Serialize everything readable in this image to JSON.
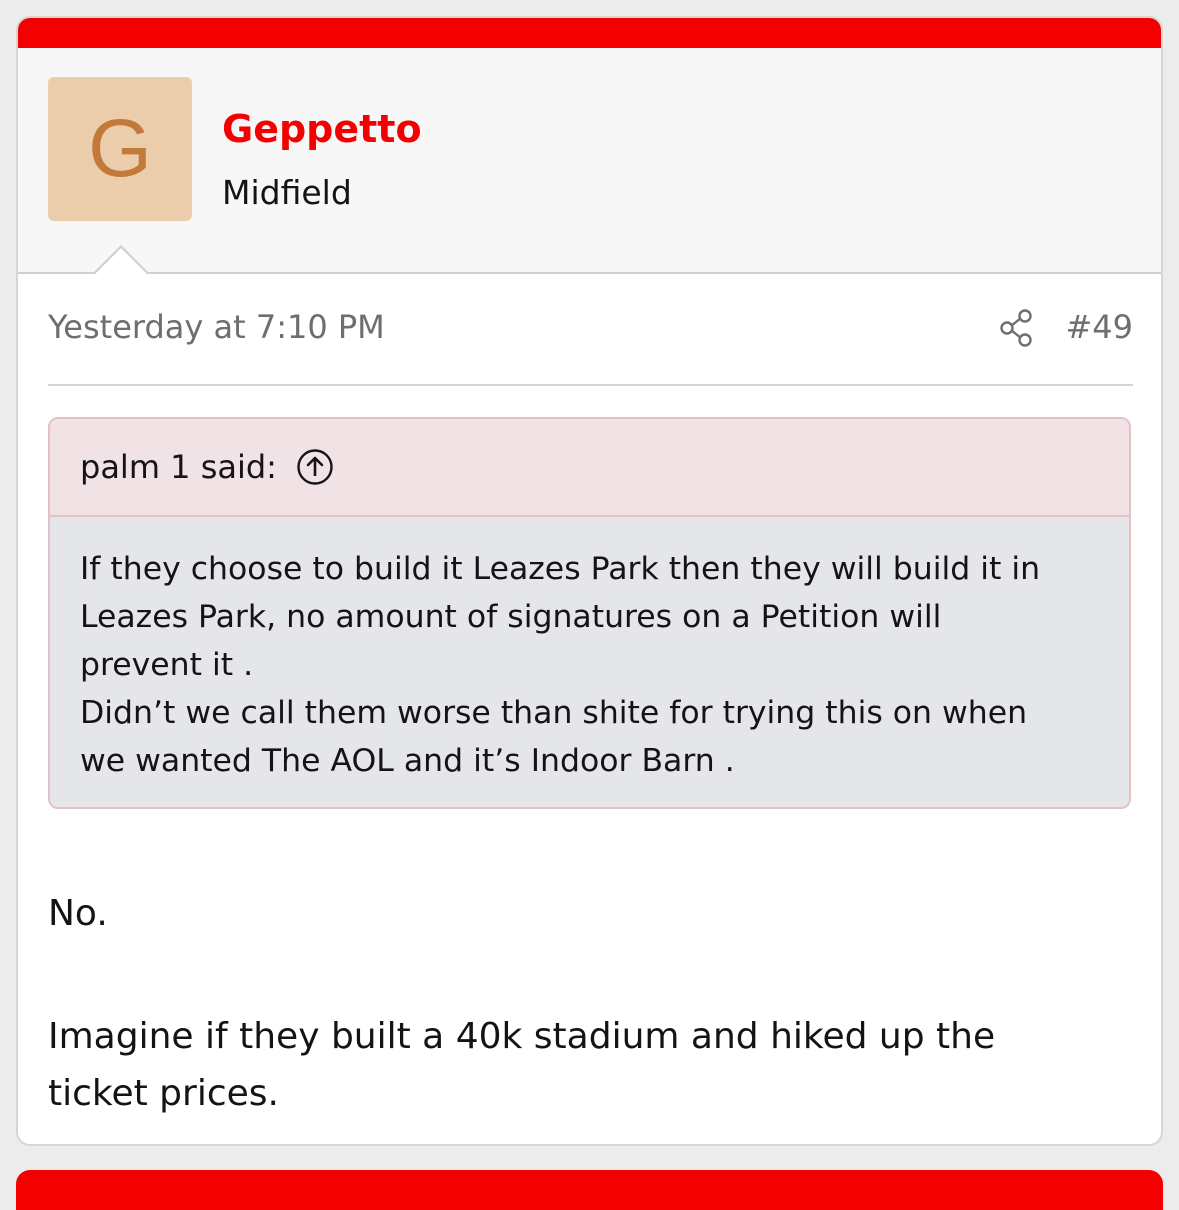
{
  "post": {
    "author": {
      "avatar_letter": "G",
      "username": "Geppetto",
      "user_title": "Midfield"
    },
    "meta": {
      "date": "Yesterday at 7:10 PM",
      "post_number": "#49",
      "share_icon": "share-icon"
    },
    "quote": {
      "author_label": "palm 1 said:",
      "jump_icon": "arrow-up-circle-icon",
      "lines": [
        "If they choose to build it Leazes Park then they will build it in",
        "Leazes Park, no amount of signatures on a Petition will",
        "prevent it .",
        "Didn’t we call them worse than shite for trying this on when",
        "we wanted The AOL and it’s Indoor Barn ."
      ]
    },
    "reply": {
      "line1": "No.",
      "para2_lines": [
        "Imagine if they built a 40k stadium and hiked up the",
        "ticket prices."
      ]
    }
  },
  "colors": {
    "accent": "#f50000",
    "avatar_bg": "#ebcdac",
    "avatar_letter": "#c2793a",
    "quote_header_bg": "#f1e2e5",
    "quote_body_bg": "#e4e6ea",
    "quote_border": "#e2c2c7",
    "meta_text": "#6e6e6e"
  }
}
